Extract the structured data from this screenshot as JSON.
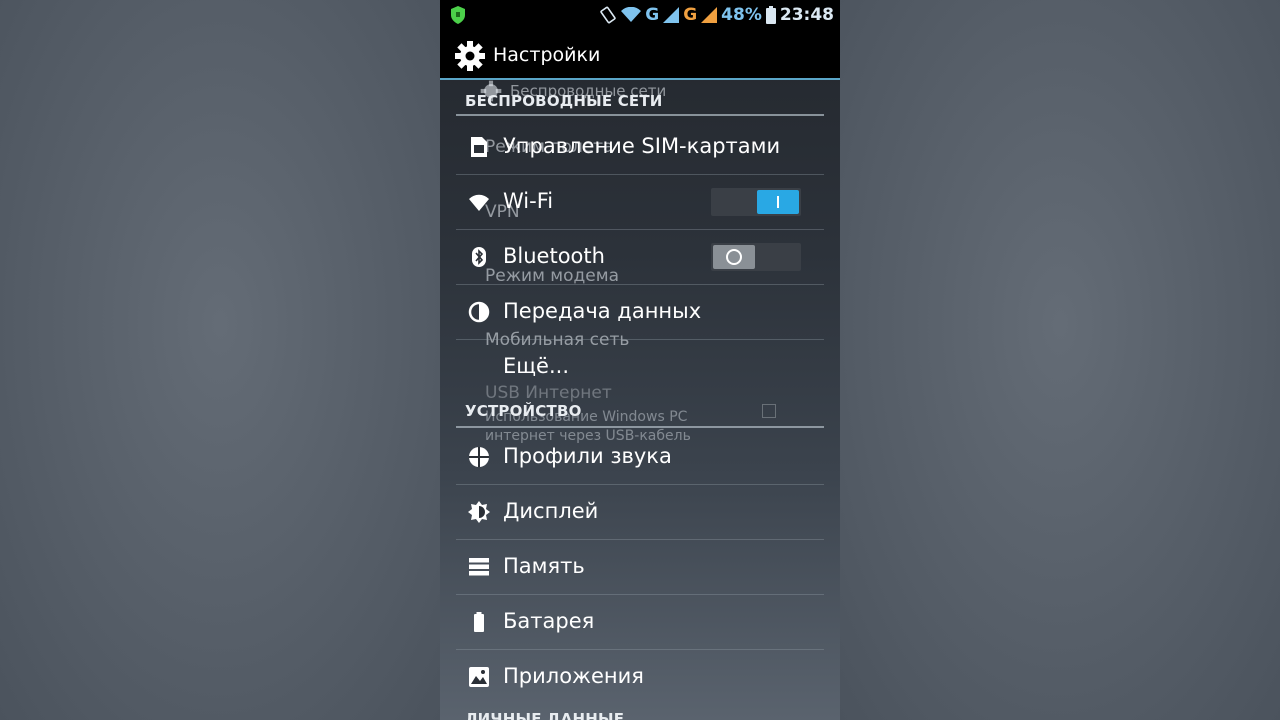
{
  "status_bar": {
    "signal_1": "G",
    "signal_2": "G",
    "battery": "48%",
    "time": "23:48"
  },
  "action_bar": {
    "title": "Настройки"
  },
  "ghost_layer": {
    "header": "Беспроводные сети",
    "item_1": "Режим полета",
    "item_2": "VPN",
    "item_3": "Режим модема",
    "item_4": "Мобильная сеть",
    "item_5": "USB Интернет",
    "item_5_sub_1": "Использование Windows PC",
    "item_5_sub_2": "интернет через USB-кабель"
  },
  "sections": {
    "wireless": "БЕСПРОВОДНЫЕ СЕТИ",
    "device": "УСТРОЙСТВО",
    "personal": "ЛИЧНЫЕ ДАННЫЕ"
  },
  "items": {
    "sim": "Управление SIM-картами",
    "wifi": "Wi-Fi",
    "bluetooth": "Bluetooth",
    "data": "Передача данных",
    "more": "Ещё...",
    "sound": "Профили звука",
    "display": "Дисплей",
    "memory": "Память",
    "battery": "Батарея",
    "apps": "Приложения"
  },
  "toggles": {
    "wifi": "on",
    "bluetooth": "off"
  },
  "colors": {
    "accent": "#29a8e4",
    "status_icons": "#7fc3ee",
    "divider": "#5aa6c8"
  }
}
